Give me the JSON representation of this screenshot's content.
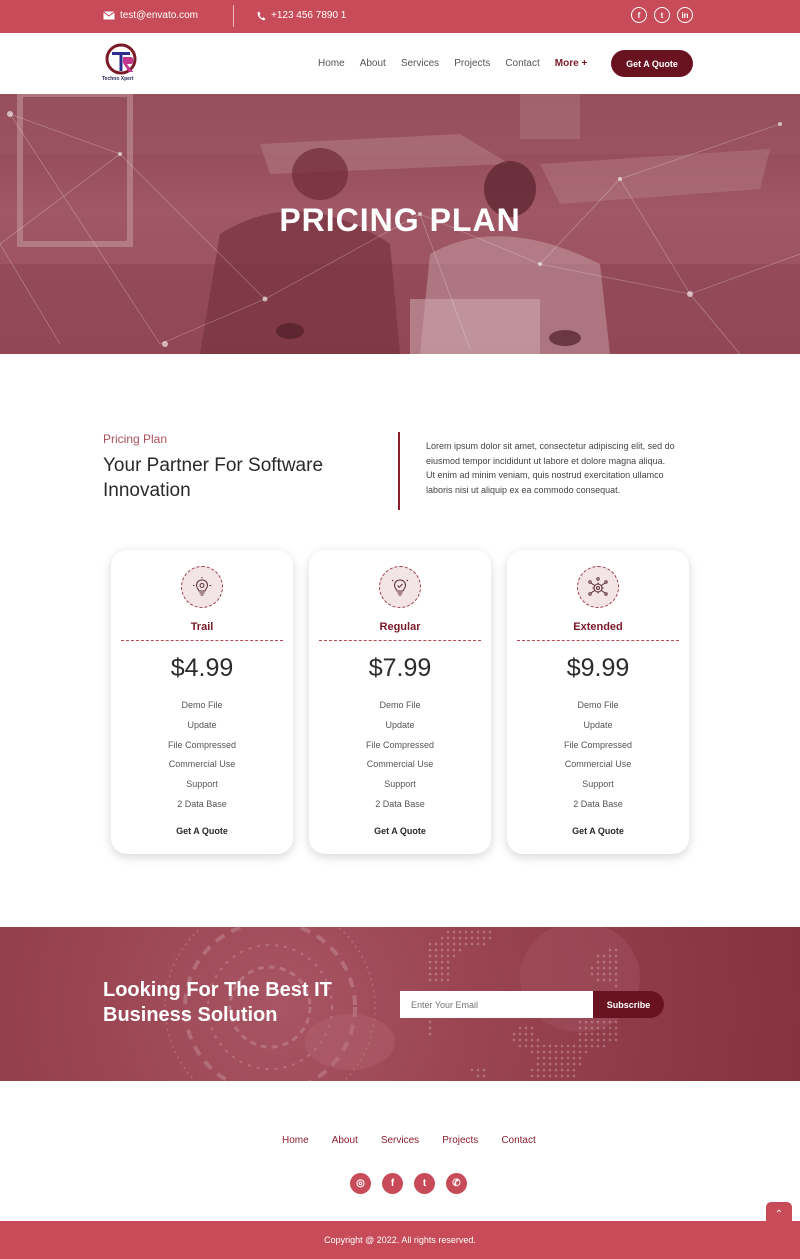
{
  "topbar": {
    "email": "test@envato.com",
    "phone": "+123 456 7890 1",
    "socials": [
      {
        "name": "facebook-icon",
        "glyph": "f"
      },
      {
        "name": "twitter-icon",
        "glyph": "t"
      },
      {
        "name": "linkedin-icon",
        "glyph": "in"
      }
    ]
  },
  "nav": {
    "logo_text": "Techno Xpert",
    "menu": [
      "Home",
      "About",
      "Services",
      "Projects",
      "Contact",
      "More +"
    ],
    "cta": "Get A Quote"
  },
  "hero": {
    "title": "PRICING PLAN"
  },
  "intro": {
    "tag": "Pricing Plan",
    "title": "Your Partner For Software Innovation",
    "text": "Lorem ipsum dolor sit amet, consectetur adipiscing elit, sed do eiusmod tempor incididunt ut labore et dolore magna aliqua. Ut enim ad minim veniam, quis nostrud exercitation ullamco laboris nisi ut aliquip ex ea commodo consequat."
  },
  "plans": [
    {
      "name": "Trail",
      "price": "$4.99",
      "icon": "lightbulb-gear-icon",
      "features": [
        "Demo File",
        "Update",
        "File Compressed",
        "Commercial Use",
        "Support",
        "2 Data Base"
      ],
      "cta": "Get A Quote"
    },
    {
      "name": "Regular",
      "price": "$7.99",
      "icon": "lightbulb-check-icon",
      "features": [
        "Demo File",
        "Update",
        "File Compressed",
        "Commercial Use",
        "Support",
        "2 Data Base"
      ],
      "cta": "Get A Quote"
    },
    {
      "name": "Extended",
      "price": "$9.99",
      "icon": "gear-network-icon",
      "features": [
        "Demo File",
        "Update",
        "File Compressed",
        "Commercial Use",
        "Support",
        "2 Data Base"
      ],
      "cta": "Get A Quote"
    }
  ],
  "newsletter": {
    "title": "Looking For The Best IT Business Solution",
    "placeholder": "Enter Your Email",
    "button": "Subscribe"
  },
  "footer": {
    "menu": [
      "Home",
      "About",
      "Services",
      "Projects",
      "Contact"
    ],
    "socials": [
      {
        "name": "instagram-icon",
        "glyph": "◎"
      },
      {
        "name": "facebook-icon",
        "glyph": "f"
      },
      {
        "name": "twitter-icon",
        "glyph": "t"
      },
      {
        "name": "whatsapp-icon",
        "glyph": "✆"
      }
    ],
    "to_top_glyph": "⌃",
    "copyright": "Copyright @ 2022. All rights reserved."
  },
  "colors": {
    "primary": "#c74b59",
    "dark_accent": "#6a1320",
    "heading": "#2a2a2a"
  }
}
